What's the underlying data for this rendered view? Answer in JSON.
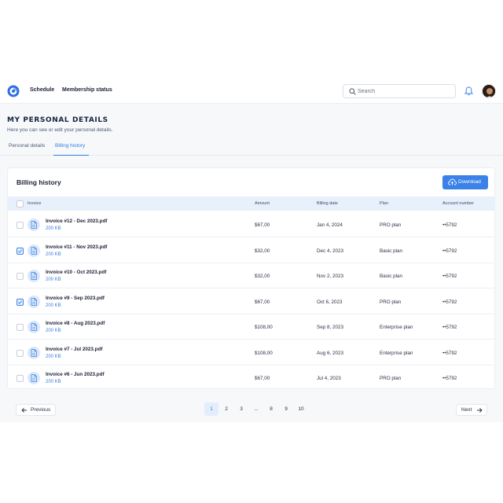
{
  "nav": {
    "links": [
      "Schedule",
      "Membership status"
    ],
    "search_placeholder": "Search"
  },
  "page": {
    "title": "MY PERSONAL DETAILS",
    "subtitle": "Here you can see or edit your personal details.",
    "tabs": [
      {
        "label": "Personal details",
        "active": false
      },
      {
        "label": "Billing history",
        "active": true
      }
    ]
  },
  "billing": {
    "title": "Billing history",
    "download_label": "Download",
    "columns": [
      "Invoice",
      "Amount",
      "Billing date",
      "Plan",
      "Account number"
    ],
    "rows": [
      {
        "name": "Invoice #12 - Dec 2023.pdf",
        "size": "200 KB",
        "amount": "$67,00",
        "date": "Jan 4, 2024",
        "plan": "PRO plan",
        "account": "••5792",
        "checked": false
      },
      {
        "name": "Invoice #11 - Nov 2023.pdf",
        "size": "200 KB",
        "amount": "$32,00",
        "date": "Dec 4, 2023",
        "plan": "Basic plan",
        "account": "••5792",
        "checked": true
      },
      {
        "name": "Invoice #10 - Oct 2023.pdf",
        "size": "200 KB",
        "amount": "$32,00",
        "date": "Nov 2, 2023",
        "plan": "Basic plan",
        "account": "••5792",
        "checked": false
      },
      {
        "name": "Invoice #9 - Sep 2023.pdf",
        "size": "200 KB",
        "amount": "$67,00",
        "date": "Oct 6, 2023",
        "plan": "PRO plan",
        "account": "••5792",
        "checked": true
      },
      {
        "name": "Invoice #8 - Aug 2023.pdf",
        "size": "200 KB",
        "amount": "$108,00",
        "date": "Sep 8, 2023",
        "plan": "Enterprise plan",
        "account": "••5792",
        "checked": false
      },
      {
        "name": "Invoice #7 - Jul 2023.pdf",
        "size": "200 KB",
        "amount": "$108,00",
        "date": "Aug 6, 2023",
        "plan": "Enterprise plan",
        "account": "••5792",
        "checked": false
      },
      {
        "name": "Invoice #6 - Jun 2023.pdf",
        "size": "200 KB",
        "amount": "$67,00",
        "date": "Jul 4, 2023",
        "plan": "PRO plan",
        "account": "••5792",
        "checked": false
      }
    ]
  },
  "pagination": {
    "previous_label": "Previous",
    "next_label": "Next",
    "pages": [
      "1",
      "2",
      "3",
      "...",
      "8",
      "9",
      "10"
    ],
    "current": "1"
  },
  "colors": {
    "accent": "#3b82e8",
    "title": "#12233f",
    "header_bg": "#e8f0fc"
  },
  "icons": {
    "logo": "logo-icon",
    "search": "search-icon",
    "notifications": "bell-icon",
    "download": "cloud-upload-icon",
    "file": "document-icon",
    "previous": "arrow-left-icon",
    "next": "arrow-right-icon"
  }
}
